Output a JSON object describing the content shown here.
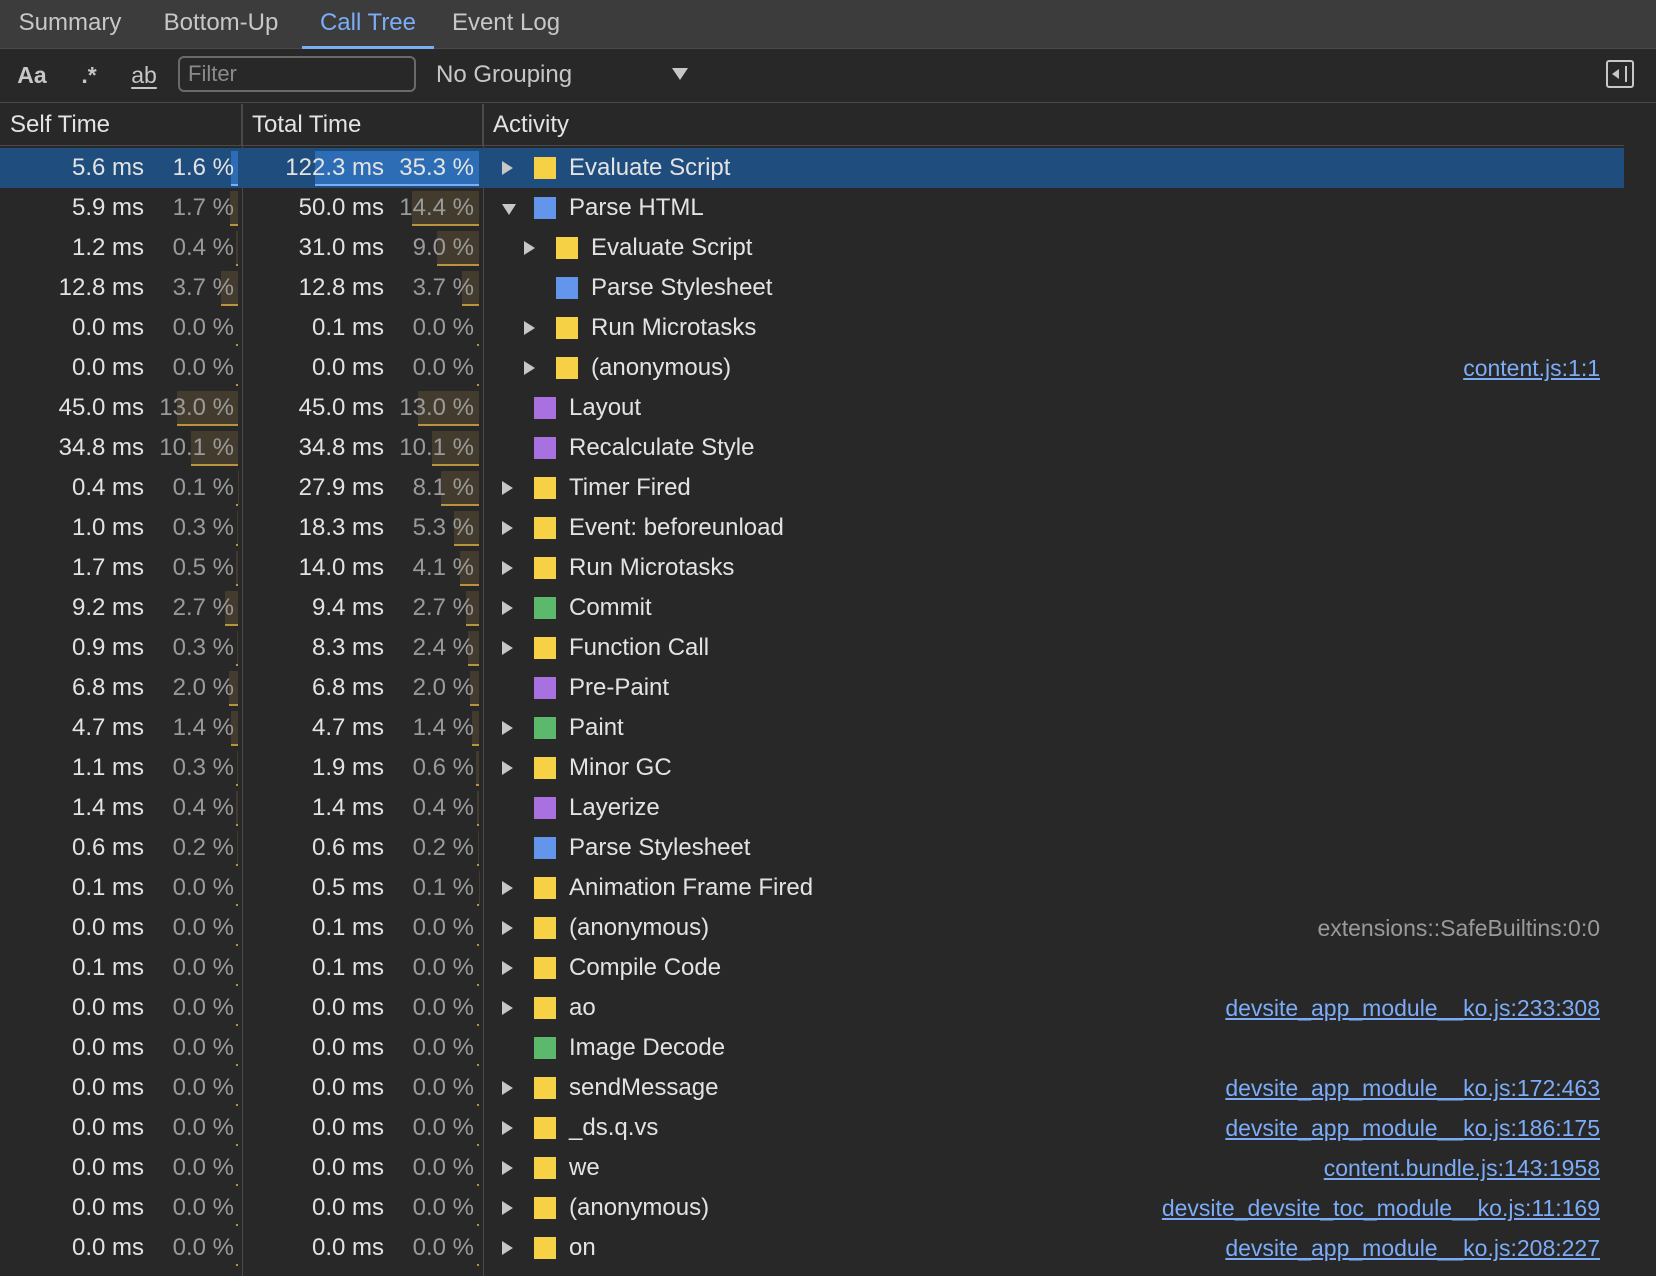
{
  "tabs": [
    {
      "label": "Summary",
      "active": false
    },
    {
      "label": "Bottom-Up",
      "active": false
    },
    {
      "label": "Call Tree",
      "active": true
    },
    {
      "label": "Event Log",
      "active": false
    }
  ],
  "toolbar": {
    "match_case_label": "Aa",
    "regex_label": ".*",
    "whole_word_label": "ab",
    "filter_placeholder": "Filter",
    "filter_value": "",
    "grouping_value": "No Grouping",
    "grouping_icon": "chevron-down-icon",
    "sidebar_toggle_icon": "sidebar-toggle-icon"
  },
  "columns": {
    "self_time": "Self Time",
    "total_time": "Total Time",
    "activity": "Activity"
  },
  "colors": {
    "scripting": "#f6d145",
    "loading": "#6495ed",
    "rendering": "#a971e0",
    "painting": "#5cb86b",
    "selected_row": "#1f4d7e",
    "link": "#7cacf8"
  },
  "rows": [
    {
      "self": "5.6 ms",
      "self_pct": "1.6 %",
      "self_frac": 0.016,
      "total": "122.3 ms",
      "total_pct": "35.3 %",
      "total_frac": 0.353,
      "expander": "collapsed",
      "depth": 0,
      "category": "scripting",
      "name": "Evaluate Script",
      "url": "",
      "selected": true
    },
    {
      "self": "5.9 ms",
      "self_pct": "1.7 %",
      "self_frac": 0.017,
      "total": "50.0 ms",
      "total_pct": "14.4 %",
      "total_frac": 0.144,
      "expander": "expanded",
      "depth": 0,
      "category": "loading",
      "name": "Parse HTML",
      "url": ""
    },
    {
      "self": "1.2 ms",
      "self_pct": "0.4 %",
      "self_frac": 0.004,
      "total": "31.0 ms",
      "total_pct": "9.0 %",
      "total_frac": 0.09,
      "expander": "collapsed",
      "depth": 1,
      "category": "scripting",
      "name": "Evaluate Script",
      "url": ""
    },
    {
      "self": "12.8 ms",
      "self_pct": "3.7 %",
      "self_frac": 0.037,
      "total": "12.8 ms",
      "total_pct": "3.7 %",
      "total_frac": 0.037,
      "expander": "none",
      "depth": 1,
      "category": "loading",
      "name": "Parse Stylesheet",
      "url": ""
    },
    {
      "self": "0.0 ms",
      "self_pct": "0.0 %",
      "self_frac": 0,
      "total": "0.1 ms",
      "total_pct": "0.0 %",
      "total_frac": 0,
      "expander": "collapsed",
      "depth": 1,
      "category": "scripting",
      "name": "Run Microtasks",
      "url": ""
    },
    {
      "self": "0.0 ms",
      "self_pct": "0.0 %",
      "self_frac": 0,
      "total": "0.0 ms",
      "total_pct": "0.0 %",
      "total_frac": 0,
      "expander": "collapsed",
      "depth": 1,
      "category": "scripting",
      "name": "(anonymous)",
      "url": "content.js:1:1",
      "url_link": true
    },
    {
      "self": "45.0 ms",
      "self_pct": "13.0 %",
      "self_frac": 0.13,
      "total": "45.0 ms",
      "total_pct": "13.0 %",
      "total_frac": 0.13,
      "expander": "none",
      "depth": 0,
      "category": "rendering",
      "name": "Layout",
      "url": ""
    },
    {
      "self": "34.8 ms",
      "self_pct": "10.1 %",
      "self_frac": 0.101,
      "total": "34.8 ms",
      "total_pct": "10.1 %",
      "total_frac": 0.101,
      "expander": "none",
      "depth": 0,
      "category": "rendering",
      "name": "Recalculate Style",
      "url": ""
    },
    {
      "self": "0.4 ms",
      "self_pct": "0.1 %",
      "self_frac": 0.001,
      "total": "27.9 ms",
      "total_pct": "8.1 %",
      "total_frac": 0.081,
      "expander": "collapsed",
      "depth": 0,
      "category": "scripting",
      "name": "Timer Fired",
      "url": ""
    },
    {
      "self": "1.0 ms",
      "self_pct": "0.3 %",
      "self_frac": 0.003,
      "total": "18.3 ms",
      "total_pct": "5.3 %",
      "total_frac": 0.053,
      "expander": "collapsed",
      "depth": 0,
      "category": "scripting",
      "name": "Event: beforeunload",
      "url": ""
    },
    {
      "self": "1.7 ms",
      "self_pct": "0.5 %",
      "self_frac": 0.005,
      "total": "14.0 ms",
      "total_pct": "4.1 %",
      "total_frac": 0.041,
      "expander": "collapsed",
      "depth": 0,
      "category": "scripting",
      "name": "Run Microtasks",
      "url": ""
    },
    {
      "self": "9.2 ms",
      "self_pct": "2.7 %",
      "self_frac": 0.027,
      "total": "9.4 ms",
      "total_pct": "2.7 %",
      "total_frac": 0.027,
      "expander": "collapsed",
      "depth": 0,
      "category": "painting",
      "name": "Commit",
      "url": ""
    },
    {
      "self": "0.9 ms",
      "self_pct": "0.3 %",
      "self_frac": 0.003,
      "total": "8.3 ms",
      "total_pct": "2.4 %",
      "total_frac": 0.024,
      "expander": "collapsed",
      "depth": 0,
      "category": "scripting",
      "name": "Function Call",
      "url": ""
    },
    {
      "self": "6.8 ms",
      "self_pct": "2.0 %",
      "self_frac": 0.02,
      "total": "6.8 ms",
      "total_pct": "2.0 %",
      "total_frac": 0.02,
      "expander": "none",
      "depth": 0,
      "category": "rendering",
      "name": "Pre-Paint",
      "url": ""
    },
    {
      "self": "4.7 ms",
      "self_pct": "1.4 %",
      "self_frac": 0.014,
      "total": "4.7 ms",
      "total_pct": "1.4 %",
      "total_frac": 0.014,
      "expander": "collapsed",
      "depth": 0,
      "category": "painting",
      "name": "Paint",
      "url": ""
    },
    {
      "self": "1.1 ms",
      "self_pct": "0.3 %",
      "self_frac": 0.003,
      "total": "1.9 ms",
      "total_pct": "0.6 %",
      "total_frac": 0.006,
      "expander": "collapsed",
      "depth": 0,
      "category": "scripting",
      "name": "Minor GC",
      "url": ""
    },
    {
      "self": "1.4 ms",
      "self_pct": "0.4 %",
      "self_frac": 0.004,
      "total": "1.4 ms",
      "total_pct": "0.4 %",
      "total_frac": 0.004,
      "expander": "none",
      "depth": 0,
      "category": "rendering",
      "name": "Layerize",
      "url": ""
    },
    {
      "self": "0.6 ms",
      "self_pct": "0.2 %",
      "self_frac": 0.002,
      "total": "0.6 ms",
      "total_pct": "0.2 %",
      "total_frac": 0.002,
      "expander": "none",
      "depth": 0,
      "category": "loading",
      "name": "Parse Stylesheet",
      "url": ""
    },
    {
      "self": "0.1 ms",
      "self_pct": "0.0 %",
      "self_frac": 0,
      "total": "0.5 ms",
      "total_pct": "0.1 %",
      "total_frac": 0.001,
      "expander": "collapsed",
      "depth": 0,
      "category": "scripting",
      "name": "Animation Frame Fired",
      "url": ""
    },
    {
      "self": "0.0 ms",
      "self_pct": "0.0 %",
      "self_frac": 0,
      "total": "0.1 ms",
      "total_pct": "0.0 %",
      "total_frac": 0,
      "expander": "collapsed",
      "depth": 0,
      "category": "scripting",
      "name": "(anonymous)",
      "url": "extensions::SafeBuiltins:0:0",
      "url_link": false
    },
    {
      "self": "0.1 ms",
      "self_pct": "0.0 %",
      "self_frac": 0,
      "total": "0.1 ms",
      "total_pct": "0.0 %",
      "total_frac": 0,
      "expander": "collapsed",
      "depth": 0,
      "category": "scripting",
      "name": "Compile Code",
      "url": ""
    },
    {
      "self": "0.0 ms",
      "self_pct": "0.0 %",
      "self_frac": 0,
      "total": "0.0 ms",
      "total_pct": "0.0 %",
      "total_frac": 0,
      "expander": "collapsed",
      "depth": 0,
      "category": "scripting",
      "name": "ao",
      "url": "devsite_app_module__ko.js:233:308",
      "url_link": true
    },
    {
      "self": "0.0 ms",
      "self_pct": "0.0 %",
      "self_frac": 0,
      "total": "0.0 ms",
      "total_pct": "0.0 %",
      "total_frac": 0,
      "expander": "none",
      "depth": 0,
      "category": "painting",
      "name": "Image Decode",
      "url": ""
    },
    {
      "self": "0.0 ms",
      "self_pct": "0.0 %",
      "self_frac": 0,
      "total": "0.0 ms",
      "total_pct": "0.0 %",
      "total_frac": 0,
      "expander": "collapsed",
      "depth": 0,
      "category": "scripting",
      "name": "sendMessage",
      "url": "devsite_app_module__ko.js:172:463",
      "url_link": true
    },
    {
      "self": "0.0 ms",
      "self_pct": "0.0 %",
      "self_frac": 0,
      "total": "0.0 ms",
      "total_pct": "0.0 %",
      "total_frac": 0,
      "expander": "collapsed",
      "depth": 0,
      "category": "scripting",
      "name": "_ds.q.vs",
      "url": "devsite_app_module__ko.js:186:175",
      "url_link": true
    },
    {
      "self": "0.0 ms",
      "self_pct": "0.0 %",
      "self_frac": 0,
      "total": "0.0 ms",
      "total_pct": "0.0 %",
      "total_frac": 0,
      "expander": "collapsed",
      "depth": 0,
      "category": "scripting",
      "name": "we",
      "url": "content.bundle.js:143:1958",
      "url_link": true
    },
    {
      "self": "0.0 ms",
      "self_pct": "0.0 %",
      "self_frac": 0,
      "total": "0.0 ms",
      "total_pct": "0.0 %",
      "total_frac": 0,
      "expander": "collapsed",
      "depth": 0,
      "category": "scripting",
      "name": "(anonymous)",
      "url": "devsite_devsite_toc_module__ko.js:11:169",
      "url_link": true
    },
    {
      "self": "0.0 ms",
      "self_pct": "0.0 %",
      "self_frac": 0,
      "total": "0.0 ms",
      "total_pct": "0.0 %",
      "total_frac": 0,
      "expander": "collapsed",
      "depth": 0,
      "category": "scripting",
      "name": "on",
      "url": "devsite_app_module__ko.js:208:227",
      "url_link": true
    }
  ]
}
